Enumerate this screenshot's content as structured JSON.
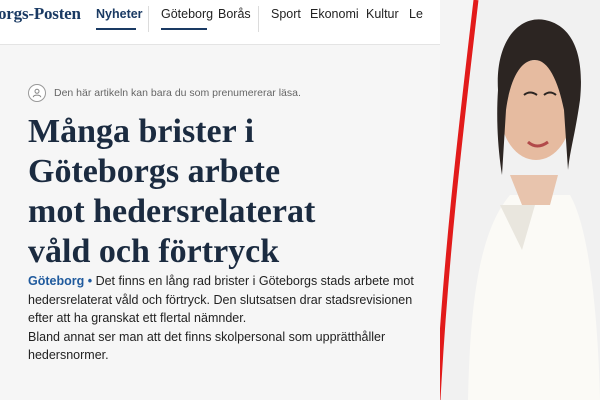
{
  "header": {
    "logo_text": "orgs-Posten",
    "nav": {
      "nyheter": "Nyheter",
      "goteborg": "Göteborg",
      "boras": "Borås",
      "sport": "Sport",
      "ekonomi": "Ekonomi",
      "kultur": "Kultur",
      "more": "Le"
    }
  },
  "article": {
    "subscriber_note": "Den här artikeln kan bara du som prenumererar läsa.",
    "headline": [
      "Många brister i",
      "Göteborgs arbete",
      "mot hedersrelaterat",
      "våld och förtryck"
    ],
    "dateline": "Göteborg •",
    "lead": " Det finns en lång rad brister i Göteborgs stads arbete mot hedersrelaterat våld och förtryck. Den slutsatsen drar stadsrevisionen efter att ha granskat ett flertal nämnder.",
    "paragraph2": "Bland annat ser man att det finns skolpersonal som upprätthåller hedersnormer."
  },
  "colors": {
    "brand": "#1a3a63",
    "accent_curve": "#e21b1b",
    "dateline": "#1f5a9d"
  }
}
